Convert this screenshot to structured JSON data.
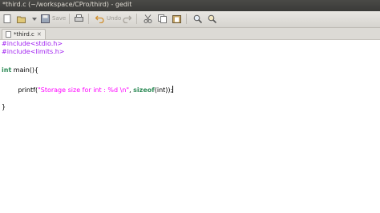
{
  "window": {
    "title": "*third.c (~/workspace/CPro/third) - gedit"
  },
  "toolbar": {
    "labels": [
      "Save",
      "Undo"
    ]
  },
  "tab": {
    "label": "*third.c"
  },
  "code": {
    "line1_pp": "#include<stdio.h>",
    "line2_pp": "#include<limits.h>",
    "line4_type": "int",
    "line4_rest": " main(){",
    "line6_indent": "        ",
    "line6_fn": "printf(",
    "line6_str": "\"Storage size for int : %d \\n\"",
    "line6_mid": ", ",
    "line6_kw": "sizeof",
    "line6_end": "(int));",
    "line8": "}"
  },
  "colors": {
    "preprocessor": "#a020f0",
    "keyword": "#2e8b57",
    "string": "#ff00ff",
    "titlebar": "#3c3b37"
  }
}
